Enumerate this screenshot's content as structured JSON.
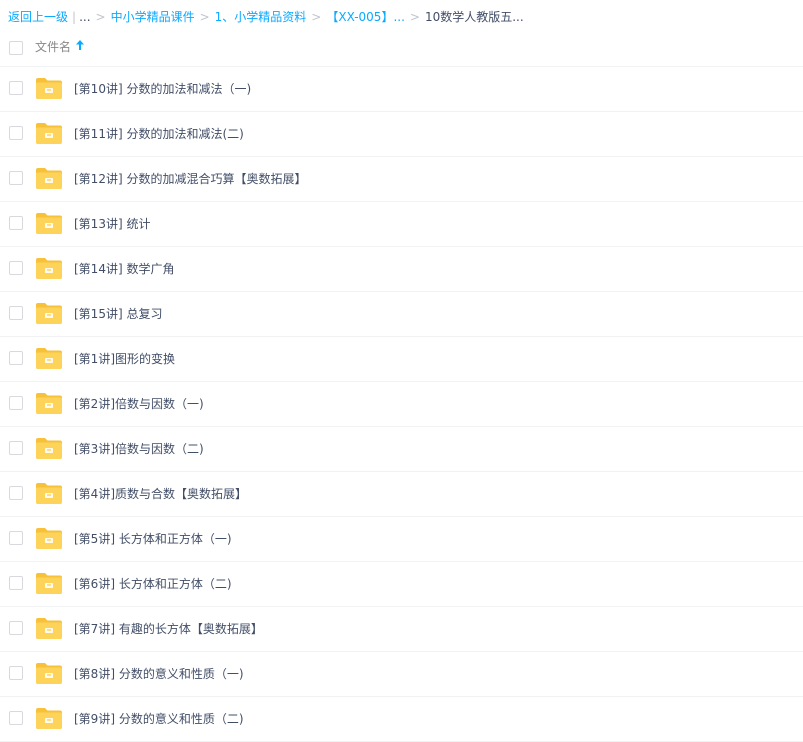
{
  "breadcrumb": {
    "back": "返回上一级",
    "bar": "|",
    "ellipsis": "...",
    "sep": ">",
    "crumb1": "中小学精品课件",
    "crumb2": "1、小学精品资料",
    "crumb3": "【XX-005】...",
    "current": "10数学人教版五..."
  },
  "header": {
    "name_col": "文件名",
    "sort_icon": "arrow-up-icon"
  },
  "colors": {
    "link": "#09aaff",
    "text": "#424e67",
    "folder": "#fdd35a",
    "folder_dark": "#f7c13a"
  },
  "files": [
    {
      "name": "[第10讲] 分数的加法和减法（一)",
      "icon": "folder-icon"
    },
    {
      "name": "[第11讲] 分数的加法和减法(二)",
      "icon": "folder-icon"
    },
    {
      "name": "[第12讲] 分数的加减混合巧算【奥数拓展】",
      "icon": "folder-icon"
    },
    {
      "name": "[第13讲] 统计",
      "icon": "folder-icon"
    },
    {
      "name": "[第14讲] 数学广角",
      "icon": "folder-icon"
    },
    {
      "name": "[第15讲] 总复习",
      "icon": "folder-icon"
    },
    {
      "name": "[第1讲]图形的变换",
      "icon": "folder-icon"
    },
    {
      "name": "[第2讲]倍数与因数（一)",
      "icon": "folder-icon"
    },
    {
      "name": "[第3讲]倍数与因数（二)",
      "icon": "folder-icon"
    },
    {
      "name": "[第4讲]质数与合数【奥数拓展】",
      "icon": "folder-icon"
    },
    {
      "name": "[第5讲] 长方体和正方体（一)",
      "icon": "folder-icon"
    },
    {
      "name": "[第6讲] 长方体和正方体（二)",
      "icon": "folder-icon"
    },
    {
      "name": "[第7讲] 有趣的长方体【奥数拓展】",
      "icon": "folder-icon"
    },
    {
      "name": "[第8讲] 分数的意义和性质（一)",
      "icon": "folder-icon"
    },
    {
      "name": "[第9讲] 分数的意义和性质（二)",
      "icon": "folder-icon"
    }
  ]
}
